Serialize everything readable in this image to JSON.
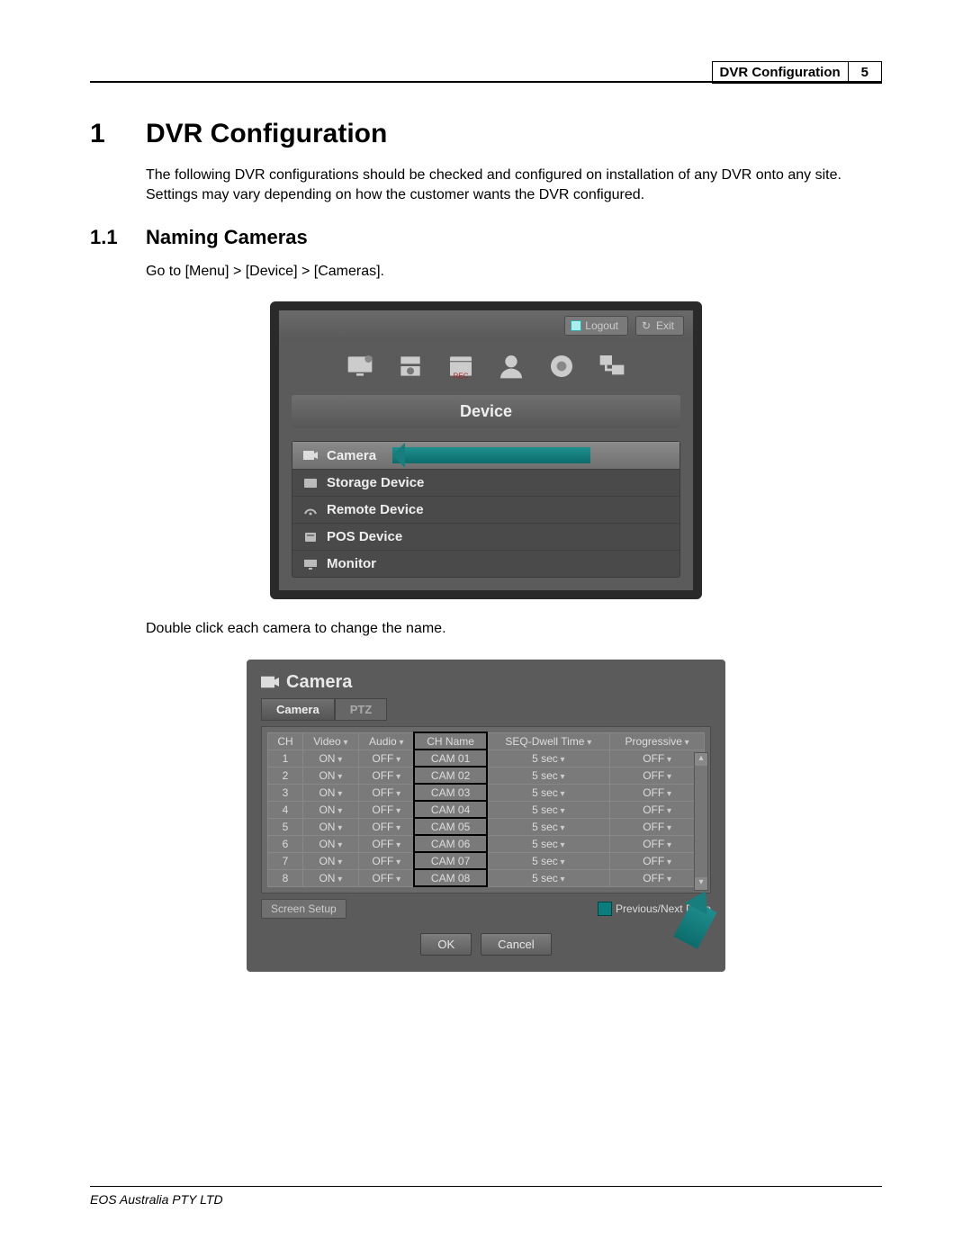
{
  "header": {
    "title": "DVR Configuration",
    "page_number": "5"
  },
  "section1": {
    "number": "1",
    "title": "DVR Configuration",
    "intro": "The following DVR configurations should be checked and configured on installation of any DVR onto any site. Settings may vary depending on how the customer wants the DVR configured."
  },
  "section1_1": {
    "number": "1.1",
    "title": "Naming Cameras",
    "step1": "Go to [Menu] > [Device] > [Cameras].",
    "step2": "Double click each camera to change the name."
  },
  "dvr_menu": {
    "logout": "Logout",
    "exit": "Exit",
    "device_header": "Device",
    "items": [
      {
        "label": "Camera",
        "selected": true
      },
      {
        "label": "Storage Device",
        "selected": false
      },
      {
        "label": "Remote Device",
        "selected": false
      },
      {
        "label": "POS Device",
        "selected": false
      },
      {
        "label": "Monitor",
        "selected": false
      }
    ]
  },
  "camera_screen": {
    "title": "Camera",
    "tab_active": "Camera",
    "tab_inactive": "PTZ",
    "cols": {
      "ch": "CH",
      "video": "Video",
      "audio": "Audio",
      "chname": "CH Name",
      "seq": "SEQ-Dwell Time",
      "prog": "Progressive"
    },
    "rows": [
      {
        "ch": "1",
        "video": "ON",
        "audio": "OFF",
        "name": "CAM 01",
        "seq": "5 sec",
        "prog": "OFF"
      },
      {
        "ch": "2",
        "video": "ON",
        "audio": "OFF",
        "name": "CAM 02",
        "seq": "5 sec",
        "prog": "OFF"
      },
      {
        "ch": "3",
        "video": "ON",
        "audio": "OFF",
        "name": "CAM 03",
        "seq": "5 sec",
        "prog": "OFF"
      },
      {
        "ch": "4",
        "video": "ON",
        "audio": "OFF",
        "name": "CAM 04",
        "seq": "5 sec",
        "prog": "OFF"
      },
      {
        "ch": "5",
        "video": "ON",
        "audio": "OFF",
        "name": "CAM 05",
        "seq": "5 sec",
        "prog": "OFF"
      },
      {
        "ch": "6",
        "video": "ON",
        "audio": "OFF",
        "name": "CAM 06",
        "seq": "5 sec",
        "prog": "OFF"
      },
      {
        "ch": "7",
        "video": "ON",
        "audio": "OFF",
        "name": "CAM 07",
        "seq": "5 sec",
        "prog": "OFF"
      },
      {
        "ch": "8",
        "video": "ON",
        "audio": "OFF",
        "name": "CAM 08",
        "seq": "5 sec",
        "prog": "OFF"
      }
    ],
    "prev_next": "Previous/Next Page",
    "screen_setup": "Screen Setup",
    "ok": "OK",
    "cancel": "Cancel"
  },
  "footer": "EOS Australia PTY LTD"
}
